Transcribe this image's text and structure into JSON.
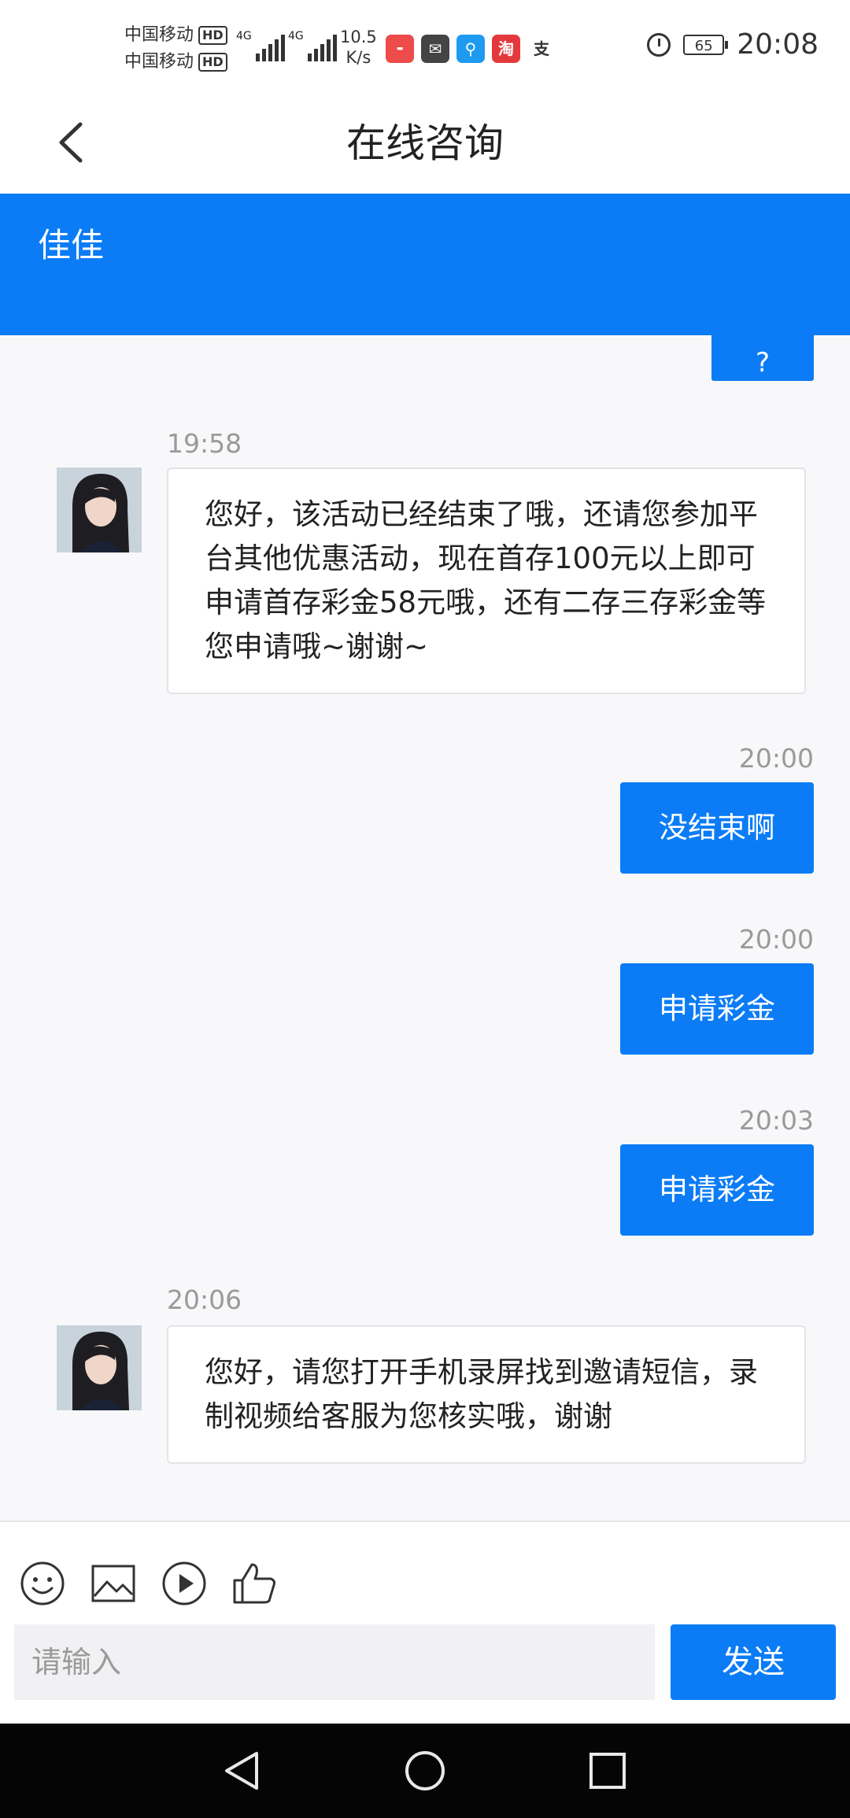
{
  "status_bar": {
    "carrier_1": "中国移动",
    "carrier_2": "中国移动",
    "hd_badge": "HD",
    "network_1": "4G",
    "network_2": "4G",
    "speed_value": "10.5",
    "speed_unit": "K/s",
    "taobao_glyph": "淘",
    "alipay_glyph": "支",
    "battery": "65",
    "time": "20:08"
  },
  "header": {
    "title": "在线咨询",
    "agent_name": "佳佳"
  },
  "chat": {
    "partial_text": "?",
    "messages": [
      {
        "side": "in",
        "time": "19:58",
        "text": "您好，该活动已经结束了哦，还请您参加平台其他优惠活动，现在首存100元以上即可申请首存彩金58元哦，还有二存三存彩金等您申请哦~谢谢~"
      },
      {
        "side": "out",
        "time": "20:00",
        "text": "没结束啊"
      },
      {
        "side": "out",
        "time": "20:00",
        "text": "申请彩金"
      },
      {
        "side": "out",
        "time": "20:03",
        "text": "申请彩金"
      },
      {
        "side": "in",
        "time": "20:06",
        "text": "您好，请您打开手机录屏找到邀请短信，录制视频给客服为您核实哦，谢谢"
      }
    ]
  },
  "composer": {
    "placeholder": "请输入",
    "send_label": "发送",
    "tools": [
      "emoji-icon",
      "image-icon",
      "video-icon",
      "thumbs-up-icon"
    ]
  },
  "colors": {
    "accent": "#0b7cf6",
    "background": "#f8f8fa",
    "navbar": "#050505"
  }
}
